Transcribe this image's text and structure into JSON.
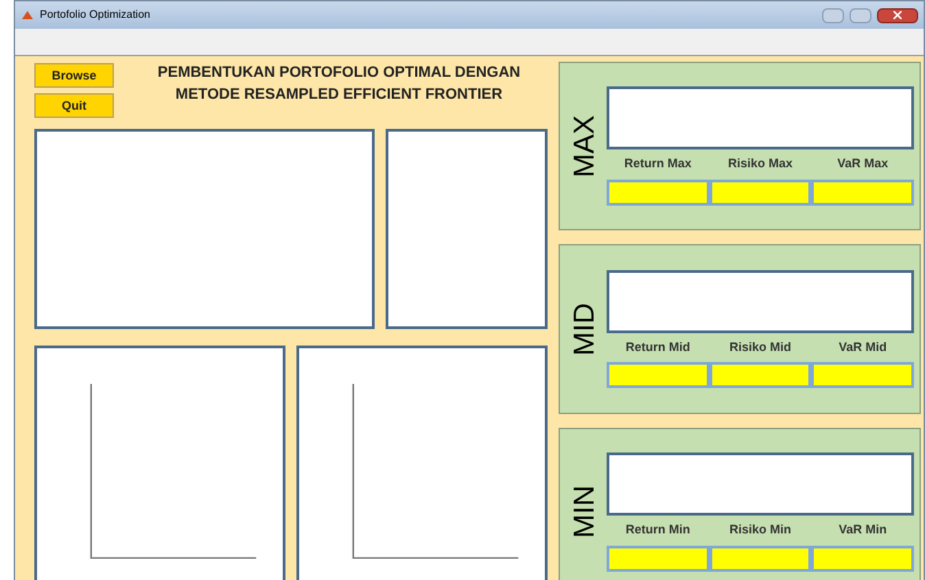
{
  "window": {
    "title": "Portofolio Optimization"
  },
  "buttons": [
    {
      "label": "Browse"
    },
    {
      "label": "Quit"
    }
  ],
  "heading": [
    "PEMBENTUKAN PORTOFOLIO OPTIMAL DENGAN",
    "METODE RESAMPLED EFFICIENT FRONTIER"
  ],
  "panels": [
    {
      "label": "MAX",
      "fields": [
        "Return Max",
        "Risiko Max",
        "VaR Max"
      ]
    },
    {
      "label": "MID",
      "fields": [
        "Return Mid",
        "Risiko Mid",
        "VaR Mid"
      ]
    },
    {
      "label": "MIN",
      "fields": [
        "Return Min",
        "Risiko Min",
        "VaR Min"
      ]
    }
  ]
}
